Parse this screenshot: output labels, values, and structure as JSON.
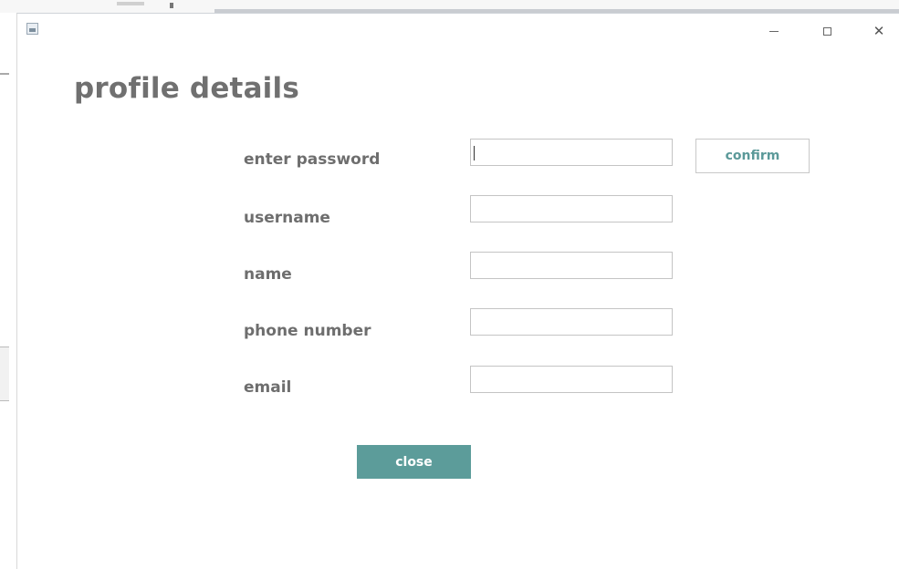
{
  "window": {
    "app_icon": "java-app-icon",
    "controls": {
      "minimize_icon": "minimize-icon",
      "maximize_icon": "maximize-icon",
      "close_icon": "close-icon",
      "close_glyph": "✕"
    }
  },
  "page": {
    "title": "profile details"
  },
  "form": {
    "fields": [
      {
        "label": "enter password",
        "value": ""
      },
      {
        "label": "username",
        "value": ""
      },
      {
        "label": "name",
        "value": ""
      },
      {
        "label": "phone number",
        "value": ""
      },
      {
        "label": "email",
        "value": ""
      }
    ],
    "confirm_label": "confirm",
    "close_label": "close"
  },
  "colors": {
    "accent": "#5c9c9a",
    "confirm_text": "#5b9999",
    "label_text": "#6e6e6e",
    "title_text": "#707070"
  }
}
